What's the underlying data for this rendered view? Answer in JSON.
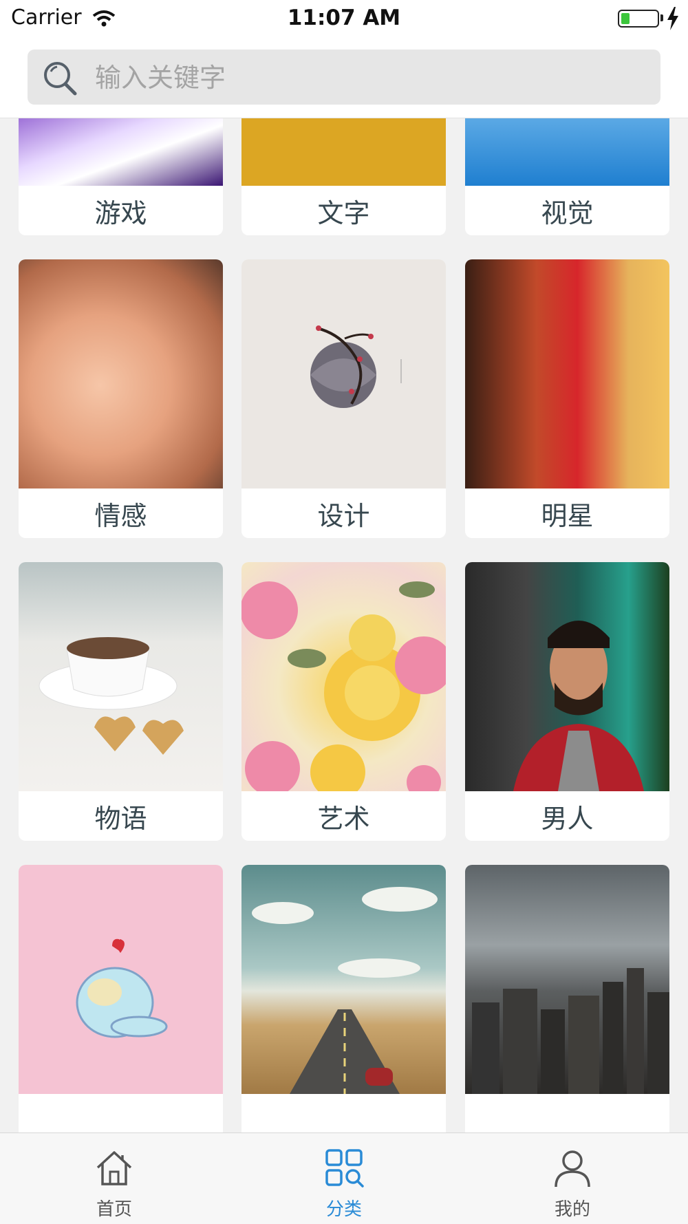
{
  "status_bar": {
    "carrier": "Carrier",
    "time": "11:07 AM",
    "battery_color": "#3cc63c"
  },
  "search": {
    "placeholder": "输入关键字",
    "value": "",
    "icon": "search-icon"
  },
  "categories": [
    {
      "label": "游戏",
      "name": "category-game"
    },
    {
      "label": "文字",
      "name": "category-text"
    },
    {
      "label": "视觉",
      "name": "category-visual"
    },
    {
      "label": "情感",
      "name": "category-emotion"
    },
    {
      "label": "设计",
      "name": "category-design"
    },
    {
      "label": "明星",
      "name": "category-star"
    },
    {
      "label": "物语",
      "name": "category-story"
    },
    {
      "label": "艺术",
      "name": "category-art"
    },
    {
      "label": "男人",
      "name": "category-man"
    },
    {
      "label": "",
      "name": "category-pink"
    },
    {
      "label": "",
      "name": "category-road"
    },
    {
      "label": "",
      "name": "category-city"
    }
  ],
  "tab_bar": {
    "active_color": "#2a8bd6",
    "tabs": [
      {
        "label": "首页",
        "icon": "home-icon",
        "active": false
      },
      {
        "label": "分类",
        "icon": "category-icon",
        "active": true
      },
      {
        "label": "我的",
        "icon": "profile-icon",
        "active": false
      }
    ]
  }
}
